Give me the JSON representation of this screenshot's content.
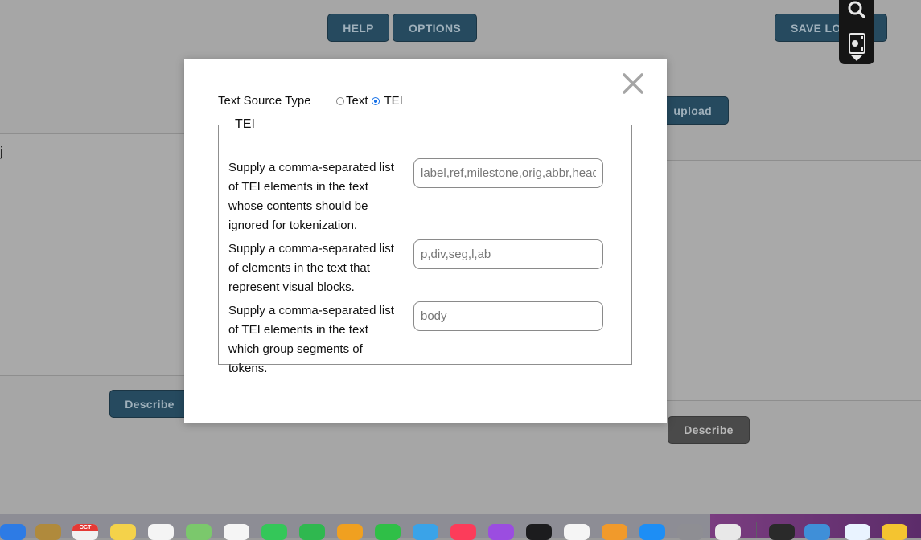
{
  "toolbar": {
    "help_label": "HELP",
    "options_label": "OPTIONS",
    "save_log_label": "SAVE LOG",
    "upload_label": "upload"
  },
  "left_panel": {
    "text": "j"
  },
  "buttons": {
    "describe_left": "Describe",
    "describe_right": "Describe"
  },
  "modal": {
    "text_source_type_label": "Text Source Type",
    "radio_text_label": "Text",
    "radio_tei_label": "TEI",
    "selected": "TEI",
    "fieldset_legend": "TEI",
    "fields": [
      {
        "label": "Supply a comma-separated list of TEI elements in the text whose contents should be ignored for tokenization.",
        "value": "label,ref,milestone,orig,abbr,head"
      },
      {
        "label": "Supply a comma-separated list of elements in the text that represent visual blocks.",
        "value": "p,div,seg,l,ab"
      },
      {
        "label": "Supply a comma-separated list of TEI elements in the text which group segments of tokens.",
        "value": "body"
      }
    ]
  },
  "floating_toolbar": {
    "icons": [
      "search-icon",
      "screen-capture-icon",
      "chevron-down-icon"
    ]
  },
  "dock": {
    "icons": [
      "mail-icon",
      "contacts-icon",
      "calendar-icon",
      "notes-icon",
      "reminders-icon",
      "maps-icon",
      "photos-icon",
      "messages-icon",
      "facetime-icon",
      "keynote-icon",
      "numbers-icon",
      "pages-icon",
      "music-icon",
      "podcasts-icon",
      "tv-icon",
      "news-icon",
      "books-icon",
      "app-store-icon",
      "system-preferences-icon",
      "chrome-icon",
      "activity-monitor-icon",
      "preview-icon",
      "safari-icon",
      "finder-icon"
    ],
    "calendar_month": "OCT"
  },
  "colors": {
    "primary_button": "#264a5f",
    "overlay": "#a6a6a6",
    "radio_accent": "#1a73e8"
  }
}
